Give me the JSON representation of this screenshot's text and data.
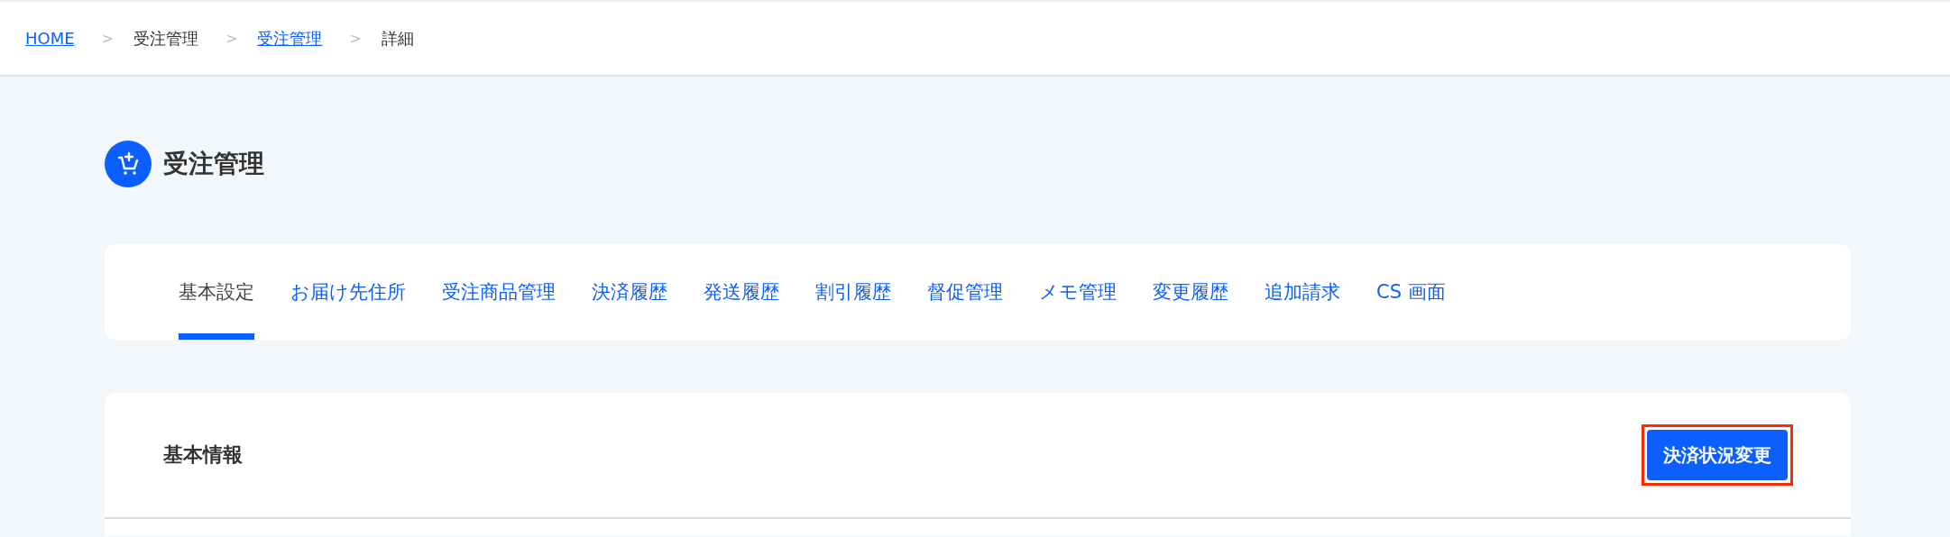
{
  "breadcrumb": [
    {
      "label": "HOME",
      "kind": "link"
    },
    {
      "label": "受注管理",
      "kind": "text"
    },
    {
      "label": "受注管理",
      "kind": "link"
    },
    {
      "label": "詳細",
      "kind": "text"
    }
  ],
  "breadcrumb_separator": ">",
  "page_title": "受注管理",
  "tabs": [
    {
      "label": "基本設定",
      "selected": true
    },
    {
      "label": "お届け先住所",
      "selected": false
    },
    {
      "label": "受注商品管理",
      "selected": false
    },
    {
      "label": "決済履歴",
      "selected": false
    },
    {
      "label": "発送履歴",
      "selected": false
    },
    {
      "label": "割引履歴",
      "selected": false
    },
    {
      "label": "督促管理",
      "selected": false
    },
    {
      "label": "メモ管理",
      "selected": false
    },
    {
      "label": "変更履歴",
      "selected": false
    },
    {
      "label": "追加請求",
      "selected": false
    },
    {
      "label": "CS 画面",
      "selected": false
    }
  ],
  "section": {
    "title": "基本情報",
    "button": {
      "label": "決済状況変更",
      "highlighted": true
    }
  }
}
